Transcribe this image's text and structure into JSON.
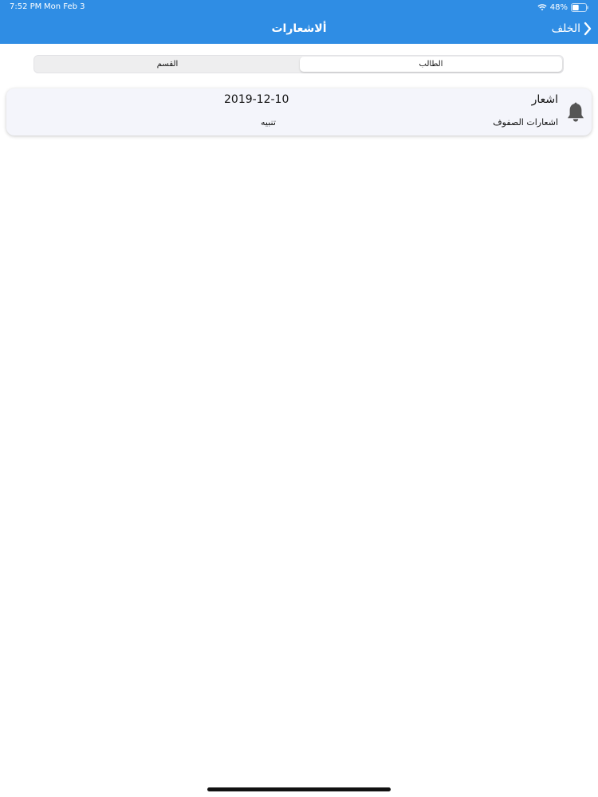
{
  "status_bar": {
    "time": "7:52 PM",
    "date": "Mon Feb 3",
    "battery": "48%",
    "battery_level": 0.48
  },
  "nav": {
    "title": "ألاشعارات",
    "back_label": "الخلف"
  },
  "segments": {
    "student": "الطالب",
    "department": "القسم",
    "selected": "student"
  },
  "notifications": [
    {
      "title": "اشعار",
      "date": "2019-12-10",
      "subtitle": "اشعارات الصفوف",
      "type": "تنبيه"
    }
  ],
  "colors": {
    "header": "#2f8de4",
    "card": "#f4f5fb",
    "icon": "#555555"
  }
}
